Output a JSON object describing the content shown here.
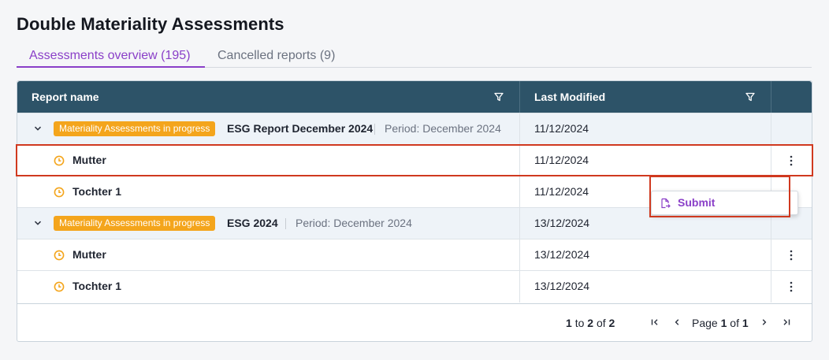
{
  "page": {
    "title": "Double Materiality Assessments"
  },
  "tabs": [
    {
      "label": "Assessments overview (195)",
      "active": true
    },
    {
      "label": "Cancelled reports (9)",
      "active": false
    }
  ],
  "columns": {
    "report_name": "Report name",
    "last_modified": "Last Modified"
  },
  "groups": [
    {
      "badge": "Materiality Assessments in progress",
      "name": "ESG Report December 2024",
      "period": "Period: December 2024",
      "date": "11/12/2024",
      "children": [
        {
          "name": "Mutter",
          "date": "11/12/2024",
          "icon": "clock-icon"
        },
        {
          "name": "Tochter 1",
          "date": "11/12/2024",
          "icon": "clock-icon"
        }
      ]
    },
    {
      "badge": "Materiality Assessments in progress",
      "name": "ESG 2024",
      "period": "Period: December 2024",
      "date": "13/12/2024",
      "children": [
        {
          "name": "Mutter",
          "date": "13/12/2024",
          "icon": "clock-icon"
        },
        {
          "name": "Tochter 1",
          "date": "13/12/2024",
          "icon": "clock-icon"
        }
      ]
    }
  ],
  "context_menu": {
    "submit_label": "Submit"
  },
  "pagination": {
    "from": "1",
    "to_word": "to",
    "to": "2",
    "of_word": "of",
    "total": "2",
    "page_word": "Page",
    "page": "1",
    "pages": "1"
  },
  "colors": {
    "header_bg": "#2d5368",
    "accent_purple": "#8a3fc8",
    "badge_orange": "#f4a51c",
    "highlight_red": "#d0391f"
  }
}
